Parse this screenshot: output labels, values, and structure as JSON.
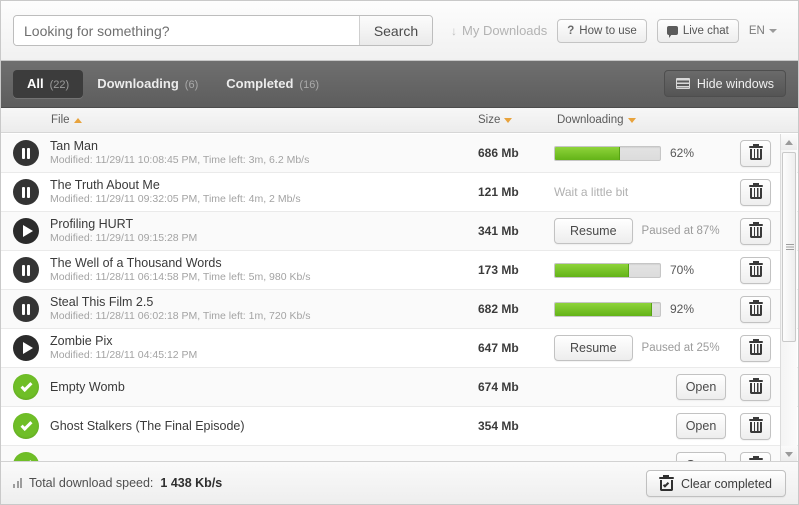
{
  "search": {
    "value": "Looking for something?",
    "placeholder": "Looking for something?",
    "button_label": "Search"
  },
  "topnav": {
    "my_downloads": "My Downloads",
    "how_to_use": "How to use",
    "how_to_use_mark": "?",
    "live_chat": "Live chat",
    "language": "EN"
  },
  "tabs": [
    {
      "label": "All",
      "count": "(22)",
      "active": true
    },
    {
      "label": "Downloading",
      "count": "(6)",
      "active": false
    },
    {
      "label": "Completed",
      "count": "(16)",
      "active": false
    }
  ],
  "hide_windows_label": "Hide windows",
  "columns": {
    "file": "File",
    "size": "Size",
    "downloading": "Downloading"
  },
  "rows": [
    {
      "status": "paused-pending",
      "name": "Tan Man",
      "meta": "Modified: 11/29/11 10:08:45 PM,  Time left: 3m,  6.2 Mb/s",
      "size": "686 Mb",
      "progress_type": "bar",
      "percent": 62,
      "percent_label": "62%",
      "delete_label": "Delete"
    },
    {
      "status": "paused-pending",
      "name": "The Truth About Me",
      "meta": "Modified: 11/29/11 09:32:05 PM,  Time left: 4m,  2 Mb/s",
      "size": "121 Mb",
      "progress_type": "wait",
      "wait_text": "Wait a little bit",
      "delete_label": "Delete"
    },
    {
      "status": "paused",
      "name": "Profiling HURT",
      "meta": "Modified: 11/29/11 09:15:28 PM",
      "size": "341 Mb",
      "progress_type": "resume",
      "resume_label": "Resume",
      "paused_label": "Paused at 87%",
      "delete_label": "Delete"
    },
    {
      "status": "paused-pending",
      "name": "The Well of a Thousand Words",
      "meta": "Modified: 11/28/11 06:14:58 PM,  Time left: 5m,  980 Kb/s",
      "size": "173 Mb",
      "progress_type": "bar",
      "percent": 70,
      "percent_label": "70%",
      "delete_label": "Delete"
    },
    {
      "status": "paused-pending",
      "name": "Steal This Film 2.5",
      "meta": "Modified: 11/28/11 06:02:18 PM,  Time left: 1m,  720 Kb/s",
      "size": "682 Mb",
      "progress_type": "bar",
      "percent": 92,
      "percent_label": "92%",
      "delete_label": "Delete"
    },
    {
      "status": "paused",
      "name": "Zombie Pix",
      "meta": "Modified: 11/28/11 04:45:12 PM",
      "size": "647 Mb",
      "progress_type": "resume",
      "resume_label": "Resume",
      "paused_label": "Paused at 25%",
      "delete_label": "Delete"
    },
    {
      "status": "done",
      "name": "Empty Womb",
      "meta": "",
      "size": "674 Mb",
      "progress_type": "open",
      "open_label": "Open",
      "delete_label": "Delete"
    },
    {
      "status": "done",
      "name": "Ghost Stalkers (The Final Episode)",
      "meta": "",
      "size": "354 Mb",
      "progress_type": "open",
      "open_label": "Open",
      "delete_label": "Delete"
    }
  ],
  "footer": {
    "speed_label": "Total download speed:",
    "speed_value": "1 438 Kb/s",
    "clear_label": "Clear completed"
  },
  "colors": {
    "progress_green": "#7bc52b",
    "sort_arrow_orange": "#e8a33d",
    "done_green": "#6fbe27"
  }
}
